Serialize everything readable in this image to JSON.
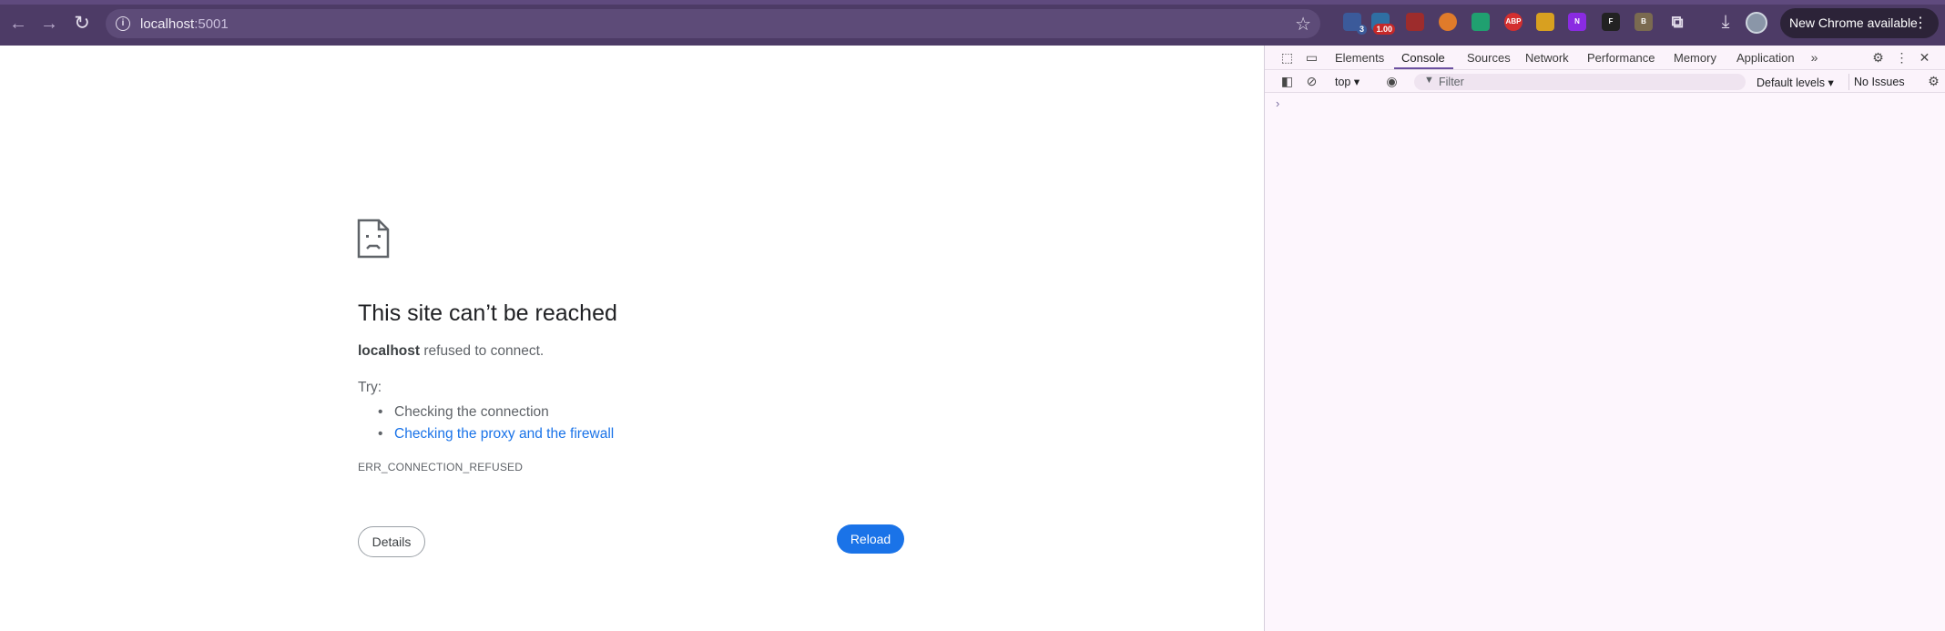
{
  "browser": {
    "url_host": "localhost",
    "url_port": ":5001",
    "update_label": "New Chrome available",
    "extensions": [
      {
        "name": "bitwarden",
        "color": "#3b5a9a",
        "badge": "3"
      },
      {
        "name": "gauge",
        "color": "#2f6fa3",
        "badge": "1.00"
      },
      {
        "name": "screen-recorder",
        "color": "#9d2c2c",
        "badge": ""
      },
      {
        "name": "metamask",
        "color": "#e07b2a",
        "badge": ""
      },
      {
        "name": "green-extension",
        "color": "#20a070",
        "badge": ""
      },
      {
        "name": "abp",
        "color": "#d32f2f",
        "badge": ""
      },
      {
        "name": "pen-extension",
        "color": "#d8a020",
        "badge": ""
      },
      {
        "name": "notion-clipper",
        "color": "#8a2be2",
        "badge": ""
      },
      {
        "name": "f-extension",
        "color": "#222222",
        "badge": ""
      },
      {
        "name": "b-extension",
        "color": "#7a6a50",
        "badge": ""
      }
    ],
    "ext_labels": {
      "abp": "ABP",
      "f": "F",
      "b": "B",
      "n": "N"
    }
  },
  "page": {
    "title": "This site can’t be reached",
    "host_bold": "localhost",
    "desc_rest": " refused to connect.",
    "try_label": "Try:",
    "suggestions": [
      "Checking the connection",
      "Checking the proxy and the firewall"
    ],
    "error_code": "ERR_CONNECTION_REFUSED",
    "details_label": "Details",
    "reload_label": "Reload"
  },
  "devtools": {
    "tabs": [
      "Elements",
      "Console",
      "Sources",
      "Network",
      "Performance",
      "Memory",
      "Application"
    ],
    "active_tab": "Console",
    "context": "top",
    "filter_placeholder": "Filter",
    "levels": "Default levels",
    "issues": "No Issues",
    "prompt": "›"
  }
}
